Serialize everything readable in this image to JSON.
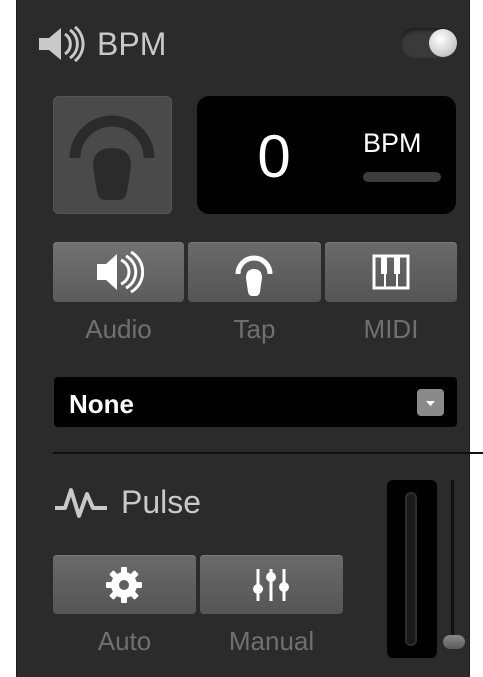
{
  "bpm_section": {
    "title": "BPM",
    "enabled": true,
    "value": "0",
    "unit": "BPM"
  },
  "sources": [
    {
      "label": "Audio",
      "icon": "speaker-icon",
      "selected": true
    },
    {
      "label": "Tap",
      "icon": "tap-icon",
      "selected": false
    },
    {
      "label": "MIDI",
      "icon": "midi-keyboard-icon",
      "selected": false
    }
  ],
  "device_select": {
    "value": "None"
  },
  "pulse_section": {
    "title": "Pulse",
    "modes": [
      {
        "label": "Auto",
        "icon": "gear-icon"
      },
      {
        "label": "Manual",
        "icon": "sliders-icon"
      }
    ],
    "level": 0
  },
  "colors": {
    "panel": "#2b2b2b",
    "display": "#000000",
    "button": "#5f5f5f",
    "label": "#707070",
    "title": "#c9c9c9"
  }
}
